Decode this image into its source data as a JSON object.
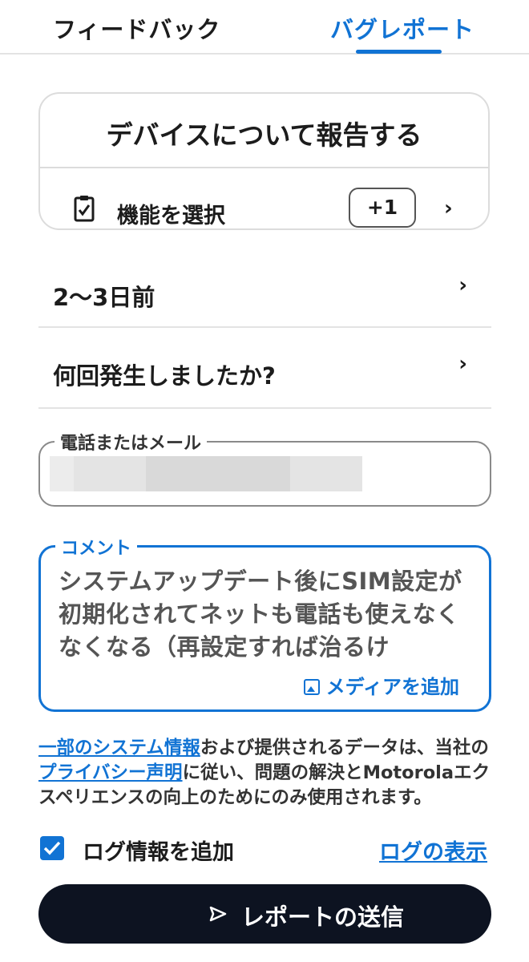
{
  "tabs": [
    {
      "label": "フィードバック"
    },
    {
      "label": "バグレポート"
    }
  ],
  "device_card": {
    "title": "デバイスについて報告する",
    "feature_label": "機能を選択",
    "count_badge": "+1"
  },
  "rows": [
    {
      "label": "2〜3日前"
    },
    {
      "label": "何回発生しましたか?"
    }
  ],
  "phone_field": {
    "legend": "電話またはメール"
  },
  "comment_field": {
    "legend": "コメント",
    "text": "システムアップデート後にSIM設定が初期化されてネットも電話も使えなくなくなる（再設定すれば治るけ",
    "add_media": "メディアを追加"
  },
  "disclaimer": {
    "link1": "一部のシステム情報",
    "text1": "および提供されるデータは、当社の",
    "link2": "プライバシー声明",
    "text2": "に従い、問題の解決とMotorolaエクスペリエンスの向上のためにのみ使用されます。"
  },
  "log": {
    "label": "ログ情報を追加",
    "checked": true,
    "view_link": "ログの表示"
  },
  "send_button": {
    "label": "レポートの送信"
  },
  "colors": {
    "accent": "#1173d4",
    "button_bg": "#0d1321"
  }
}
